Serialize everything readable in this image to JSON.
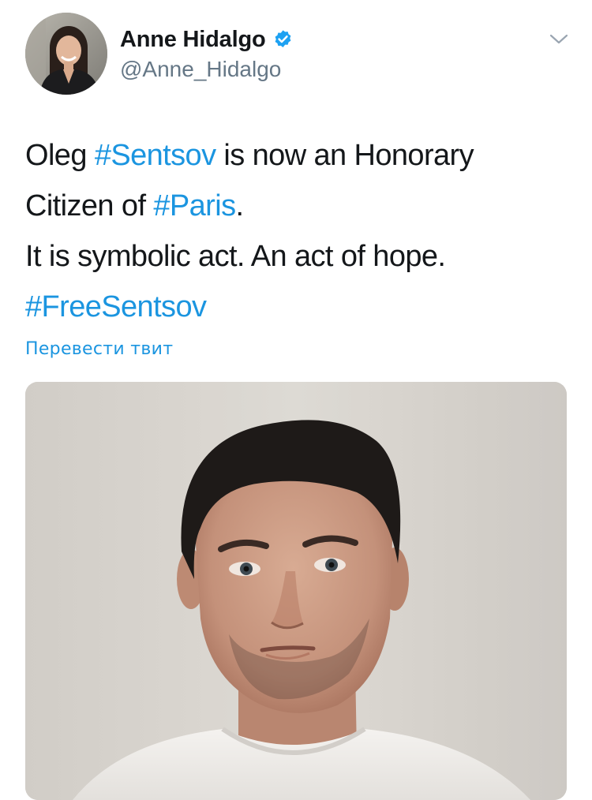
{
  "tweet": {
    "author": {
      "display_name": "Anne Hidalgo",
      "handle": "@Anne_Hidalgo",
      "verified": true,
      "avatar_icon": "profile-photo-avatar"
    },
    "text": {
      "line1_before": "Oleg ",
      "line1_hashtag": "#Sentsov",
      "line1_after": " is now an Honorary",
      "line2_before": "Citizen of ",
      "line2_hashtag": "#Paris",
      "line2_after": ".",
      "line3": "It is symbolic act. An act of hope.",
      "line4_hashtag": "#FreeSentsov"
    },
    "translate_link": "Перевести твит",
    "more_menu_icon": "chevron-down-icon",
    "media_icon": "portrait-photo",
    "colors": {
      "link": "#1b95e0",
      "text": "#14171a",
      "secondary": "#657786",
      "verified_badge": "#1da1f2"
    }
  }
}
